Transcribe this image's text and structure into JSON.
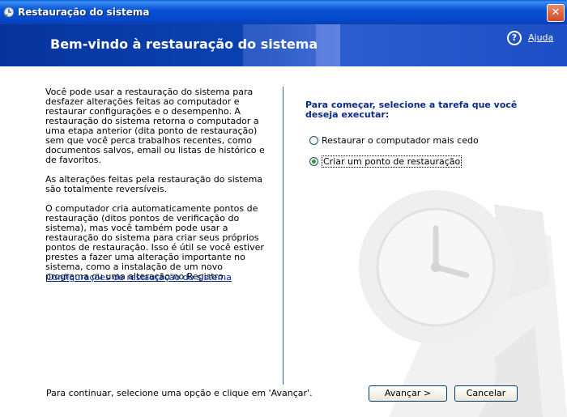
{
  "window": {
    "title": "Restauração do sistema",
    "close_glyph": "✕"
  },
  "header": {
    "title": "Bem-vindo à restauração do sistema",
    "help_label": "Ajuda",
    "help_icon": "question-circle-icon",
    "help_glyph": "?"
  },
  "left": {
    "paragraphs": [
      "Você pode usar a restauração do sistema para desfazer alterações feitas ao computador e restaurar configurações e o desempenho. A restauração do sistema retorna o computador a uma etapa anterior (dita ponto de restauração) sem que você perca trabalhos recentes, como documentos salvos, email ou listas de histórico e de favoritos.",
      "As alterações feitas pela restauração do sistema são totalmente reversíveis.",
      "O computador cria automaticamente pontos de restauração (ditos pontos de verificação do sistema), mas você também pode usar a restauração do sistema para criar seus próprios pontos de restauração. Isso é útil se você estiver prestes a fazer uma alteração importante no sistema, como a instalação de um novo programa ou uma alteração no Registro."
    ],
    "config_link": "Configurações de restauração do sistema"
  },
  "right": {
    "prompt": "Para começar, selecione a tarefa que você deseja executar:",
    "options": [
      {
        "label": "Restaurar o computador mais cedo",
        "selected": false
      },
      {
        "label": "Criar um ponto de restauração",
        "selected": true
      }
    ]
  },
  "footer": {
    "hint": "Para continuar, selecione uma opção e clique em 'Avançar'.",
    "next_label": "Avançar >",
    "cancel_label": "Cancelar"
  },
  "colors": {
    "title_bar": "#0854d4",
    "header": "#0a42b2",
    "prompt_text": "#0a2a8c",
    "link": "#0a2f9b",
    "selected_radio": "#2c9a2c"
  }
}
